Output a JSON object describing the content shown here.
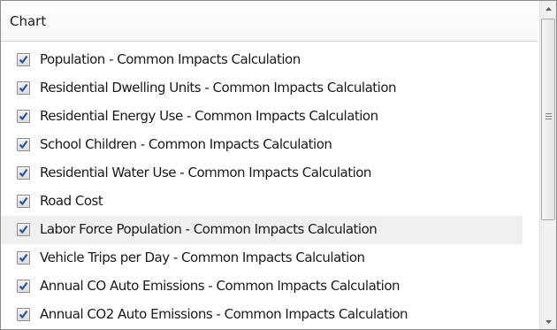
{
  "header": {
    "title": "Chart"
  },
  "rows": [
    {
      "label": "Population - Common Impacts Calculation",
      "checked": true
    },
    {
      "label": "Residential Dwelling Units - Common Impacts Calculation",
      "checked": true
    },
    {
      "label": "Residential Energy Use - Common Impacts Calculation",
      "checked": true
    },
    {
      "label": "School Children - Common Impacts Calculation",
      "checked": true
    },
    {
      "label": "Residential Water Use - Common Impacts Calculation",
      "checked": true
    },
    {
      "label": "Road Cost",
      "checked": true
    },
    {
      "label": "Labor Force Population - Common Impacts Calculation",
      "checked": true
    },
    {
      "label": "Vehicle Trips per Day - Common Impacts Calculation",
      "checked": true
    },
    {
      "label": "Annual CO Auto Emissions - Common Impacts Calculation",
      "checked": true
    },
    {
      "label": "Annual CO2 Auto Emissions - Common Impacts Calculation",
      "checked": true
    }
  ],
  "colors": {
    "check": "#2b4ea3",
    "hover_row": "#f0f0f0",
    "border": "#8c8c8c"
  },
  "scroll_position": 0,
  "icons": {
    "scroll_up": "triangle-up-icon",
    "scroll_down": "triangle-down-icon",
    "checkmark": "checkmark-icon"
  }
}
